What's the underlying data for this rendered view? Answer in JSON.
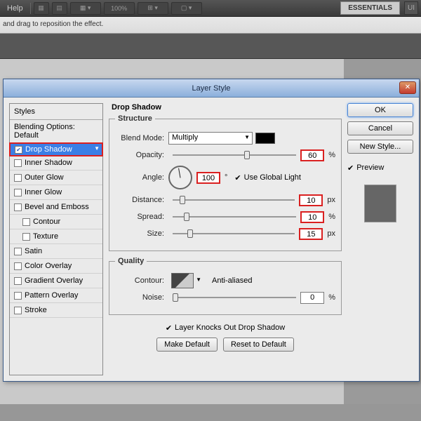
{
  "topbar": {
    "help": "Help",
    "zoom": "100%",
    "essentials": "ESSENTIALS",
    "ui": "UI"
  },
  "hint": "and drag to reposition the effect.",
  "dialog": {
    "title": "Layer Style",
    "styles_header": "Styles",
    "styles": [
      {
        "label": "Blending Options: Default",
        "cb": false
      },
      {
        "label": "Drop Shadow",
        "cb": true,
        "checked": true,
        "sel": true
      },
      {
        "label": "Inner Shadow",
        "cb": true
      },
      {
        "label": "Outer Glow",
        "cb": true
      },
      {
        "label": "Inner Glow",
        "cb": true
      },
      {
        "label": "Bevel and Emboss",
        "cb": true
      },
      {
        "label": "Contour",
        "cb": true,
        "indent": true
      },
      {
        "label": "Texture",
        "cb": true,
        "indent": true
      },
      {
        "label": "Satin",
        "cb": true
      },
      {
        "label": "Color Overlay",
        "cb": true
      },
      {
        "label": "Gradient Overlay",
        "cb": true
      },
      {
        "label": "Pattern Overlay",
        "cb": true
      },
      {
        "label": "Stroke",
        "cb": true
      }
    ],
    "panel_title": "Drop Shadow",
    "structure": {
      "legend": "Structure",
      "blend_mode_label": "Blend Mode:",
      "blend_mode": "Multiply",
      "opacity_label": "Opacity:",
      "opacity": "60",
      "opacity_unit": "%",
      "angle_label": "Angle:",
      "angle": "100",
      "angle_unit": "°",
      "use_global": "Use Global Light",
      "use_global_checked": true,
      "distance_label": "Distance:",
      "distance": "10",
      "distance_unit": "px",
      "spread_label": "Spread:",
      "spread": "10",
      "spread_unit": "%",
      "size_label": "Size:",
      "size": "15",
      "size_unit": "px"
    },
    "quality": {
      "legend": "Quality",
      "contour_label": "Contour:",
      "anti_aliased": "Anti-aliased",
      "noise_label": "Noise:",
      "noise": "0",
      "noise_unit": "%"
    },
    "knocks": "Layer Knocks Out Drop Shadow",
    "knocks_checked": true,
    "make_default": "Make Default",
    "reset_default": "Reset to Default",
    "ok": "OK",
    "cancel": "Cancel",
    "new_style": "New Style...",
    "preview": "Preview"
  }
}
